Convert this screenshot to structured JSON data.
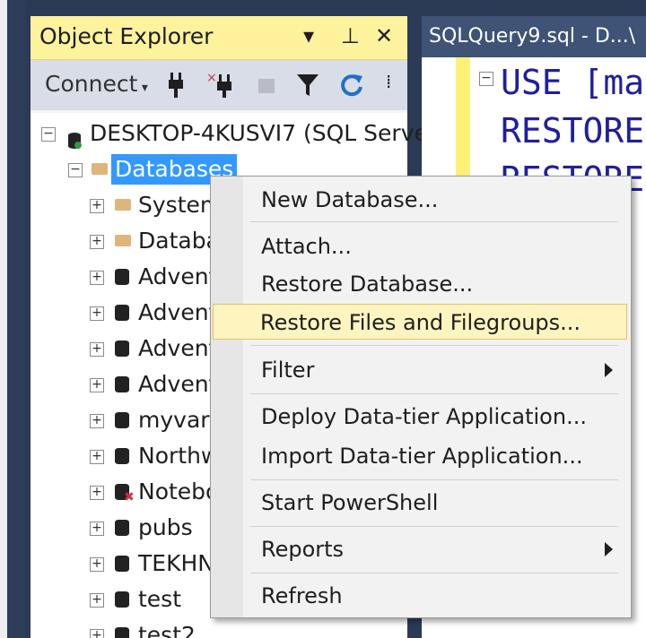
{
  "object_explorer": {
    "title": "Object Explorer",
    "controls": {
      "dropdown": "▾",
      "pin": "⊥",
      "close": "✕"
    },
    "toolbar": {
      "connect_label": "Connect",
      "overflow": "⁞"
    }
  },
  "tree": {
    "server": "DESKTOP-4KUSVI7 (SQL Server",
    "databases": "Databases",
    "items": [
      {
        "label": "System",
        "icon": "folder-icon"
      },
      {
        "label": "Databa",
        "icon": "folder-icon"
      },
      {
        "label": "Advent",
        "icon": "database-icon"
      },
      {
        "label": "Advent",
        "icon": "database-icon"
      },
      {
        "label": "Advent",
        "icon": "database-icon"
      },
      {
        "label": "Advent",
        "icon": "database-icon"
      },
      {
        "label": "myvar",
        "icon": "database-icon"
      },
      {
        "label": "Northw",
        "icon": "database-icon"
      },
      {
        "label": "Notebo",
        "icon": "database-error-icon"
      },
      {
        "label": "pubs",
        "icon": "database-icon"
      },
      {
        "label": "TEKHN",
        "icon": "database-icon"
      },
      {
        "label": "test",
        "icon": "database-icon"
      },
      {
        "label": "test2",
        "icon": "database-icon"
      }
    ]
  },
  "query_editor": {
    "tab_title": "SQLQuery9.sql - D...\\",
    "lines": [
      "USE [ma",
      "RESTORE",
      "RESTORE"
    ]
  },
  "context_menu": {
    "items": [
      {
        "label": "New Database..."
      },
      {
        "label": "Attach..."
      },
      {
        "label": "Restore Database..."
      },
      {
        "label": "Restore Files and Filegroups..."
      },
      {
        "label": "Filter"
      },
      {
        "label": "Deploy Data-tier Application..."
      },
      {
        "label": "Import Data-tier Application..."
      },
      {
        "label": "Start PowerShell"
      },
      {
        "label": "Reports"
      },
      {
        "label": "Refresh"
      }
    ]
  },
  "colors": {
    "title_bar": "#fff29d",
    "highlight": "#fdf4bf",
    "selection": "#3399ff",
    "chrome_dark": "#2b3a55",
    "code_keyword": "#1f1f9f"
  }
}
